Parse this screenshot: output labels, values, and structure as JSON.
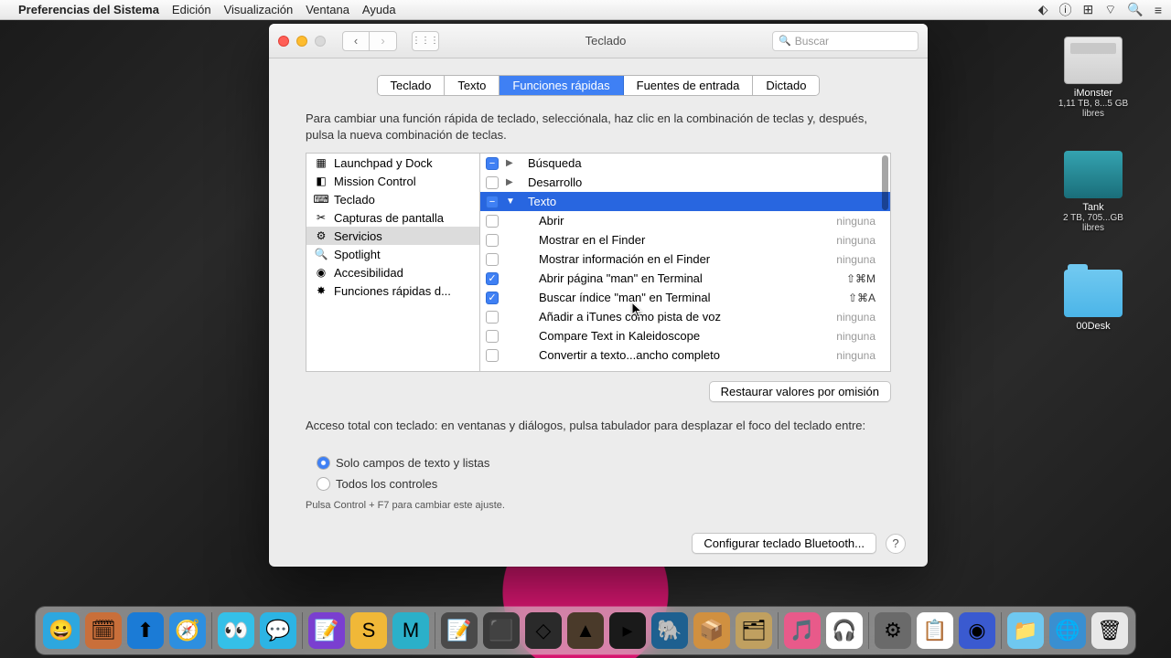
{
  "menubar": {
    "app": "Preferencias del Sistema",
    "items": [
      "Edición",
      "Visualización",
      "Ventana",
      "Ayuda"
    ]
  },
  "desktop": {
    "drives": [
      {
        "name": "iMonster",
        "sub": "1,11 TB, 8...5 GB libres"
      },
      {
        "name": "Tank",
        "sub": "2 TB, 705...GB libres"
      }
    ],
    "folder": {
      "name": "00Desk"
    }
  },
  "window": {
    "title": "Teclado",
    "search_placeholder": "Buscar",
    "tabs": [
      "Teclado",
      "Texto",
      "Funciones rápidas",
      "Fuentes de entrada",
      "Dictado"
    ],
    "active_tab": 2,
    "helptext": "Para cambiar una función rápida de teclado, selecciónala, haz clic en la combinación de teclas y, después, pulsa la nueva combinación de teclas.",
    "categories": [
      {
        "icon": "▦",
        "label": "Launchpad y Dock"
      },
      {
        "icon": "◧",
        "label": "Mission Control"
      },
      {
        "icon": "⌨",
        "label": "Teclado"
      },
      {
        "icon": "✂",
        "label": "Capturas de pantalla"
      },
      {
        "icon": "⚙",
        "label": "Servicios",
        "selected": true
      },
      {
        "icon": "🔍",
        "label": "Spotlight"
      },
      {
        "icon": "◉",
        "label": "Accesibilidad"
      },
      {
        "icon": "✸",
        "label": "Funciones rápidas d..."
      }
    ],
    "shortcuts": [
      {
        "type": "group",
        "checked": "dash",
        "expand": "▶",
        "label": "Búsqueda"
      },
      {
        "type": "group",
        "checked": false,
        "expand": "▶",
        "label": "Desarrollo"
      },
      {
        "type": "group",
        "checked": "dash",
        "expand": "▼",
        "label": "Texto",
        "selected": true
      },
      {
        "type": "item",
        "checked": false,
        "label": "Abrir",
        "shortcut": "ninguna"
      },
      {
        "type": "item",
        "checked": false,
        "label": "Mostrar en el Finder",
        "shortcut": "ninguna"
      },
      {
        "type": "item",
        "checked": false,
        "label": "Mostrar información en el Finder",
        "shortcut": "ninguna"
      },
      {
        "type": "item",
        "checked": true,
        "label": "Abrir página \"man\" en Terminal",
        "shortcut": "⇧⌘M"
      },
      {
        "type": "item",
        "checked": true,
        "label": "Buscar índice \"man\" en Terminal",
        "shortcut": "⇧⌘A"
      },
      {
        "type": "item",
        "checked": false,
        "label": "Añadir a iTunes como pista de voz",
        "shortcut": "ninguna"
      },
      {
        "type": "item",
        "checked": false,
        "label": "Compare Text in Kaleidoscope",
        "shortcut": "ninguna"
      },
      {
        "type": "item",
        "checked": false,
        "label": "Convertir a texto...ancho completo",
        "shortcut": "ninguna"
      }
    ],
    "restore_label": "Restaurar valores por omisión",
    "access_label": "Acceso total con teclado: en ventanas y diálogos, pulsa tabulador para desplazar el foco del teclado entre:",
    "radio1": "Solo campos de texto y listas",
    "radio2": "Todos los controles",
    "hint": "Pulsa Control + F7 para cambiar este ajuste.",
    "bluetooth_label": "Configurar teclado Bluetooth..."
  },
  "dock_apps": [
    {
      "bg": "#2da7df",
      "e": "😀"
    },
    {
      "bg": "#c96f3a",
      "e": "🗓"
    },
    {
      "bg": "#1b7bd6",
      "e": "⬆"
    },
    {
      "bg": "#2d8fe0",
      "e": "🧭"
    },
    {
      "bg": "#34c0e8",
      "e": "👀"
    },
    {
      "bg": "#2cb4e4",
      "e": "💬"
    },
    {
      "bg": "#7a3fd0",
      "e": "📝"
    },
    {
      "bg": "#f0b838",
      "e": "S"
    },
    {
      "bg": "#2bb0c9",
      "e": "M"
    },
    {
      "bg": "#4a4a4a",
      "e": "📝"
    },
    {
      "bg": "#3a3a3a",
      "e": "⬛"
    },
    {
      "bg": "#2a2a2a",
      "e": "◇"
    },
    {
      "bg": "#4a3a2a",
      "e": "▲"
    },
    {
      "bg": "#1a1a1a",
      "e": "▸"
    },
    {
      "bg": "#1e6090",
      "e": "🐘"
    },
    {
      "bg": "#d09040",
      "e": "📦"
    },
    {
      "bg": "#c0a060",
      "e": "🗂"
    },
    {
      "bg": "#e85a8a",
      "e": "🎵"
    },
    {
      "bg": "#fff",
      "e": "🎧"
    },
    {
      "bg": "#6a6a6a",
      "e": "⚙"
    },
    {
      "bg": "#fff",
      "e": "📋"
    },
    {
      "bg": "#3a5ad0",
      "e": "◉"
    },
    {
      "bg": "#6fc8f0",
      "e": "📁"
    },
    {
      "bg": "#3a8fd0",
      "e": "🌐"
    },
    {
      "bg": "#e8e8e8",
      "e": "🗑"
    }
  ]
}
